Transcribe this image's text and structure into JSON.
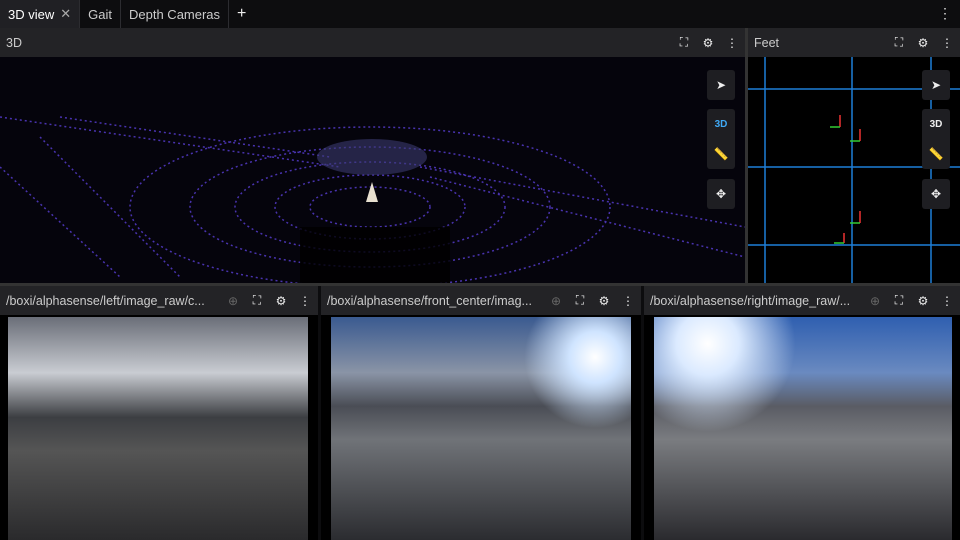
{
  "tabs": [
    {
      "label": "3D view",
      "active": true
    },
    {
      "label": "Gait"
    },
    {
      "label": "Depth Cameras"
    }
  ],
  "add_tab": "+",
  "close_glyph": "✕",
  "panels": {
    "three_d": {
      "title": "3D",
      "toggle_3d": "3D"
    },
    "feet": {
      "title": "Feet",
      "toggle_3d": "3D"
    },
    "cam_left": {
      "title": "/boxi/alphasense/left/image_raw/c..."
    },
    "cam_front": {
      "title": "/boxi/alphasense/front_center/imag..."
    },
    "cam_right": {
      "title": "/boxi/alphasense/right/image_raw/..."
    }
  },
  "colors": {
    "accent": "#3fa9f5",
    "grid": "#1e7fd8",
    "points": "#6a4cff"
  }
}
